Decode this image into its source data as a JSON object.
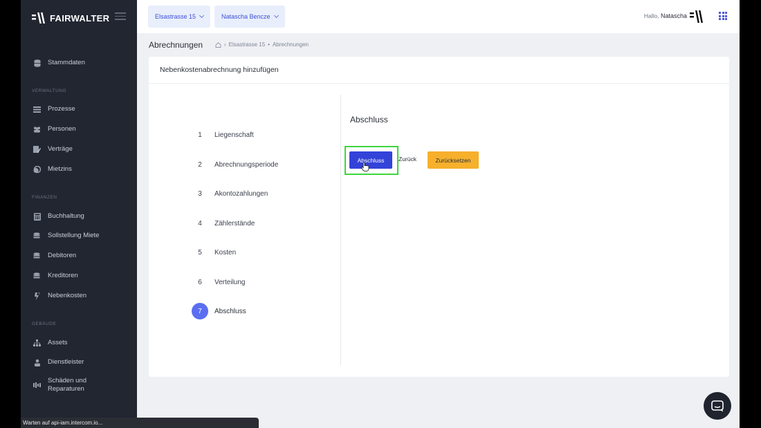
{
  "brand": {
    "name": "FAIRWALTER"
  },
  "sidebar": {
    "top_item": "Stammdaten",
    "sections": {
      "verwaltung": "VERWALTUNG",
      "finanzen": "FINANZEN",
      "gebaeude": "GEBÄUDE"
    },
    "verwaltung_items": [
      "Prozesse",
      "Personen",
      "Verträge",
      "Mietzins"
    ],
    "finanzen_items": [
      "Buchhaltung",
      "Sollstellung Miete",
      "Debitoren",
      "Kreditoren",
      "Nebenkosten"
    ],
    "gebaeude_items": [
      "Assets",
      "Dienstleister",
      "Schäden und Reparaturen"
    ]
  },
  "topbar": {
    "property_select": "Elsastrasse 15",
    "person_select": "Natascha Bencze",
    "greeting_prefix": "Hallo,",
    "user_name": "Natascha"
  },
  "breadcrumb": {
    "title": "Abrechnungen",
    "path": [
      "Elsastrasse 15",
      "Abrechnungen"
    ],
    "separator": "•"
  },
  "card": {
    "title": "Nebenkostenabrechnung hinzufügen",
    "steps": [
      {
        "num": "1",
        "label": "Liegenschaft"
      },
      {
        "num": "2",
        "label": "Abrechnungsperiode"
      },
      {
        "num": "3",
        "label": "Akontozahlungen"
      },
      {
        "num": "4",
        "label": "Zählerstände"
      },
      {
        "num": "5",
        "label": "Kosten"
      },
      {
        "num": "6",
        "label": "Verteilung"
      },
      {
        "num": "7",
        "label": "Abschluss"
      }
    ],
    "active_step": 7,
    "section_title": "Abschluss",
    "buttons": {
      "submit": "Abschluss",
      "back": "Zurück",
      "reset": "Zurücksetzen"
    }
  },
  "status_bar": "Warten auf api-iam.intercom.io...",
  "colors": {
    "sidebar_bg": "#222631",
    "primary": "#3343d8",
    "warning": "#f6b02c",
    "active_step": "#5b6ef0",
    "highlight": "#3cd63c"
  }
}
